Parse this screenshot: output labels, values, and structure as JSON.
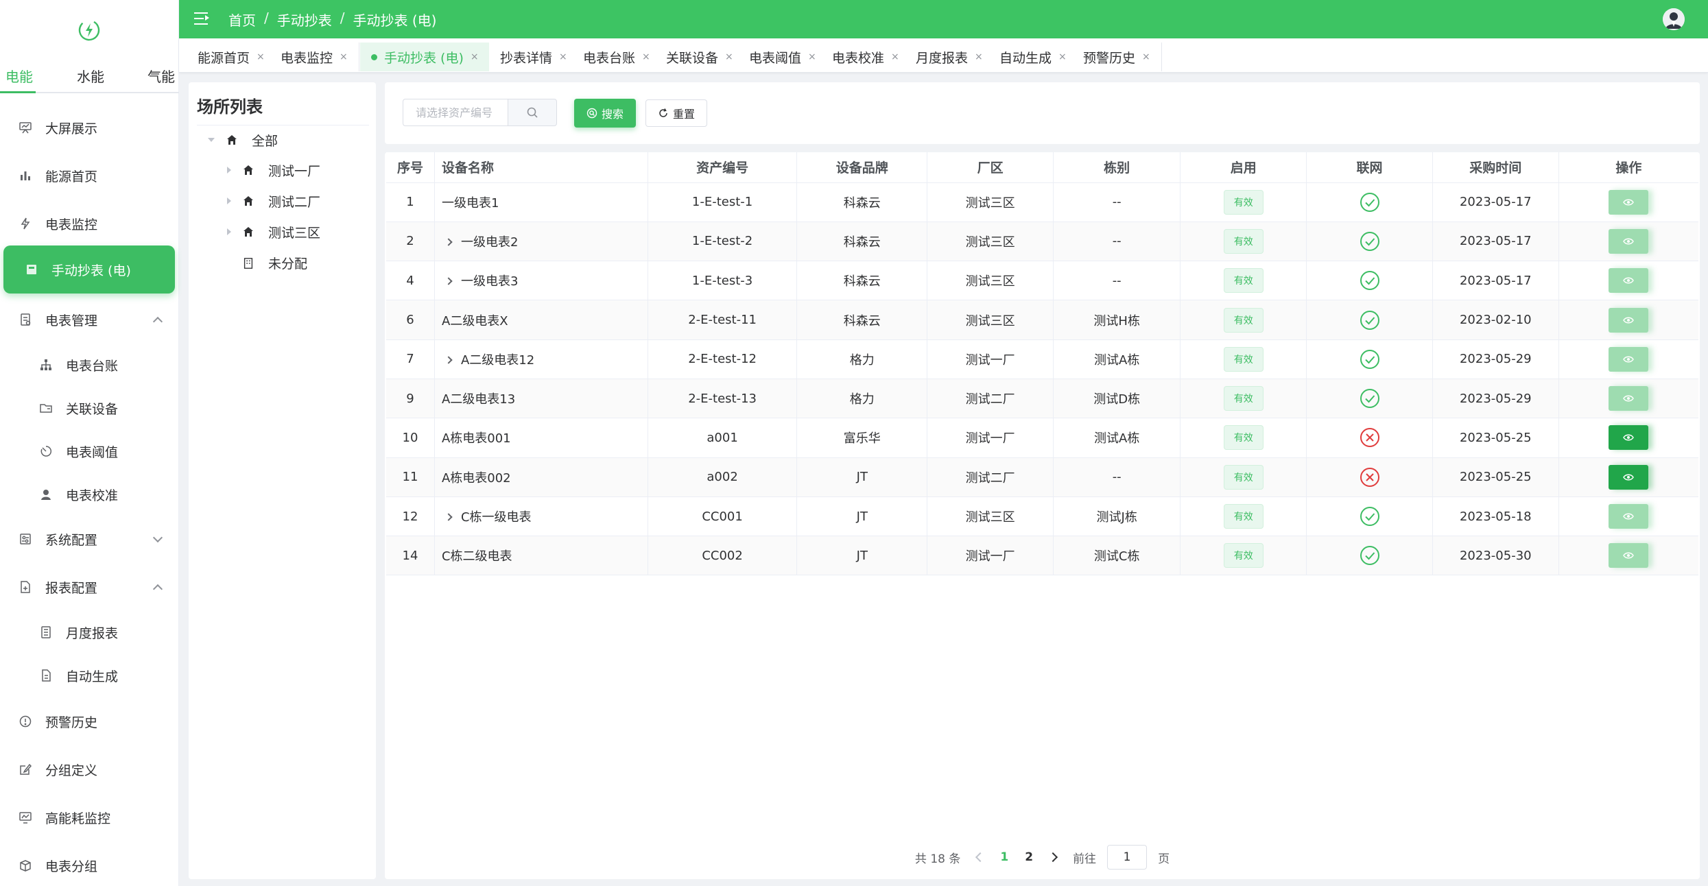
{
  "sidebar": {
    "energy_tabs": [
      "电能",
      "水能",
      "气能"
    ],
    "active_energy_tab": 0,
    "menu": [
      {
        "label": "大屏展示",
        "icon": "presentation-icon",
        "name": "menu-big-screen"
      },
      {
        "label": "能源首页",
        "icon": "bar-chart-icon",
        "name": "menu-energy-home"
      },
      {
        "label": "电表监控",
        "icon": "lightning-icon",
        "name": "menu-meter-monitor"
      },
      {
        "label": "手动抄表 (电)",
        "icon": "archive-box-icon",
        "name": "menu-manual-reading",
        "active": true
      },
      {
        "label": "电表管理",
        "icon": "document-list-icon",
        "name": "menu-meter-management",
        "expanded": true
      },
      {
        "label": "电表台账",
        "icon": "sitemap-icon",
        "name": "menu-meter-ledger",
        "sub": true
      },
      {
        "label": "关联设备",
        "icon": "folder-icon",
        "name": "menu-related-devices",
        "sub": true
      },
      {
        "label": "电表阈值",
        "icon": "gauge-icon",
        "name": "menu-meter-threshold",
        "sub": true
      },
      {
        "label": "电表校准",
        "icon": "user-icon",
        "name": "menu-meter-calibration",
        "sub": true
      },
      {
        "label": "系统配置",
        "icon": "settings-panel-icon",
        "name": "menu-system-config",
        "collapsed": true
      },
      {
        "label": "报表配置",
        "icon": "report-icon",
        "name": "menu-report-config",
        "expanded": true
      },
      {
        "label": "月度报表",
        "icon": "report-list-icon",
        "name": "menu-monthly-report",
        "sub": true
      },
      {
        "label": "自动生成",
        "icon": "document-icon",
        "name": "menu-auto-generate",
        "sub": true
      },
      {
        "label": "预警历史",
        "icon": "warning-circle-icon",
        "name": "menu-alert-history"
      },
      {
        "label": "分组定义",
        "icon": "edit-icon",
        "name": "menu-group-definition"
      },
      {
        "label": "高能耗监控",
        "icon": "monitor-chart-icon",
        "name": "menu-high-consumption"
      },
      {
        "label": "电表分组",
        "icon": "box-icon",
        "name": "menu-meter-groups"
      }
    ]
  },
  "topbar": {
    "breadcrumb": [
      "首页",
      "手动抄表",
      "手动抄表 (电)"
    ],
    "separator": "/"
  },
  "tags": [
    {
      "label": "能源首页"
    },
    {
      "label": "电表监控"
    },
    {
      "label": "手动抄表 (电)",
      "active": true
    },
    {
      "label": "抄表详情"
    },
    {
      "label": "电表台账"
    },
    {
      "label": "关联设备"
    },
    {
      "label": "电表阈值"
    },
    {
      "label": "电表校准"
    },
    {
      "label": "月度报表"
    },
    {
      "label": "自动生成"
    },
    {
      "label": "预警历史"
    }
  ],
  "tag_close_glyph": "×",
  "tree": {
    "title": "场所列表",
    "nodes": [
      {
        "label": "全部",
        "level": 0,
        "caret": "open",
        "icon": "home-icon"
      },
      {
        "label": "测试一厂",
        "level": 1,
        "caret": "closed",
        "icon": "home-icon"
      },
      {
        "label": "测试二厂",
        "level": 1,
        "caret": "closed",
        "icon": "home-icon"
      },
      {
        "label": "测试三区",
        "level": 1,
        "caret": "closed",
        "icon": "home-icon"
      },
      {
        "label": "未分配",
        "level": 1,
        "caret": "none",
        "icon": "building-icon"
      }
    ]
  },
  "search": {
    "placeholder": "请选择资产编号",
    "search_label": "搜索",
    "reset_label": "重置"
  },
  "table": {
    "columns": [
      "序号",
      "设备名称",
      "资产编号",
      "设备品牌",
      "厂区",
      "栋别",
      "启用",
      "联网",
      "采购时间",
      "操作"
    ],
    "rows": [
      {
        "no": "1",
        "name": "一级电表1",
        "expandable": false,
        "asset": "1-E-test-1",
        "brand": "科森云",
        "area": "测试三区",
        "building": "--",
        "enabled": "有效",
        "online": true,
        "date": "2023-05-17",
        "action": "weak"
      },
      {
        "no": "2",
        "name": "一级电表2",
        "expandable": true,
        "asset": "1-E-test-2",
        "brand": "科森云",
        "area": "测试三区",
        "building": "--",
        "enabled": "有效",
        "online": true,
        "date": "2023-05-17",
        "action": "weak"
      },
      {
        "no": "4",
        "name": "一级电表3",
        "expandable": true,
        "asset": "1-E-test-3",
        "brand": "科森云",
        "area": "测试三区",
        "building": "--",
        "enabled": "有效",
        "online": true,
        "date": "2023-05-17",
        "action": "weak"
      },
      {
        "no": "6",
        "name": "A二级电表X",
        "expandable": false,
        "asset": "2-E-test-11",
        "brand": "科森云",
        "area": "测试三区",
        "building": "测试H栋",
        "enabled": "有效",
        "online": true,
        "date": "2023-02-10",
        "action": "weak"
      },
      {
        "no": "7",
        "name": "A二级电表12",
        "expandable": true,
        "asset": "2-E-test-12",
        "brand": "格力",
        "area": "测试一厂",
        "building": "测试A栋",
        "enabled": "有效",
        "online": true,
        "date": "2023-05-29",
        "action": "weak"
      },
      {
        "no": "9",
        "name": "A二级电表13",
        "expandable": false,
        "asset": "2-E-test-13",
        "brand": "格力",
        "area": "测试二厂",
        "building": "测试D栋",
        "enabled": "有效",
        "online": true,
        "date": "2023-05-29",
        "action": "weak"
      },
      {
        "no": "10",
        "name": "A栋电表001",
        "expandable": false,
        "asset": "a001",
        "brand": "富乐华",
        "area": "测试一厂",
        "building": "测试A栋",
        "enabled": "有效",
        "online": false,
        "date": "2023-05-25",
        "action": "strong"
      },
      {
        "no": "11",
        "name": "A栋电表002",
        "expandable": false,
        "asset": "a002",
        "brand": "JT",
        "area": "测试二厂",
        "building": "--",
        "enabled": "有效",
        "online": false,
        "date": "2023-05-25",
        "action": "strong"
      },
      {
        "no": "12",
        "name": "C栋一级电表",
        "expandable": true,
        "asset": "CC001",
        "brand": "JT",
        "area": "测试三区",
        "building": "测试J栋",
        "enabled": "有效",
        "online": true,
        "date": "2023-05-18",
        "action": "weak"
      },
      {
        "no": "14",
        "name": "C栋二级电表",
        "expandable": false,
        "asset": "CC002",
        "brand": "JT",
        "area": "测试一厂",
        "building": "测试C栋",
        "enabled": "有效",
        "online": true,
        "date": "2023-05-30",
        "action": "weak"
      }
    ]
  },
  "pagination": {
    "total_text": "共 18 条",
    "pages": [
      "1",
      "2"
    ],
    "current": "1",
    "goto_label": "前往",
    "goto_value": "1",
    "page_suffix": "页"
  },
  "colors": {
    "accent": "#3dbd63",
    "topbar": "#3dc463",
    "online": "#3dbd63",
    "offline": "#e03c3c"
  }
}
